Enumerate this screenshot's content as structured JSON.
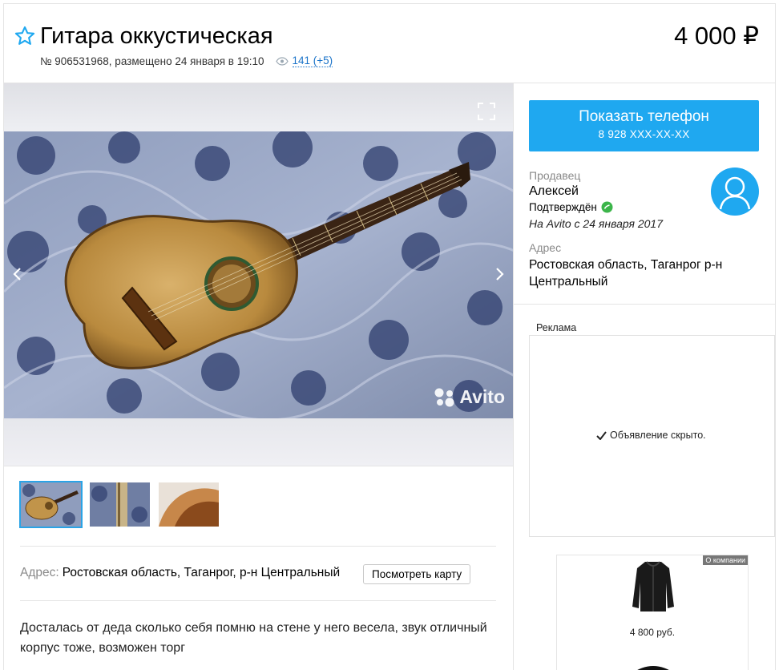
{
  "listing": {
    "title": "Гитара оккустическая",
    "price": "4 000 ₽",
    "meta": "№ 906531968, размещено 24 января в 19:10",
    "views": "141 (+5)"
  },
  "gallery": {
    "watermark": "Avito",
    "thumbnail_count": 3
  },
  "address": {
    "label": "Адрес:",
    "value": "Ростовская область, Таганрог, р-н Центральный",
    "map_button": "Посмотреть карту"
  },
  "description": "Досталась от деда сколько себя помню на стене у него весела, звук отличный корпус тоже, возможен торг",
  "contact": {
    "phone_button": "Показать телефон",
    "phone_masked": "8 928 XXX-XX-XX"
  },
  "seller": {
    "label": "Продавец",
    "name": "Алексей",
    "verified": "Подтверждён",
    "since": "На Avito с 24 января 2017",
    "address_label": "Адрес",
    "address": "Ростовская область, Таганрог р-н Центральный"
  },
  "ads": {
    "label": "Реклама",
    "hidden_text": "Объявление скрыто.",
    "company_tag": "О компании",
    "product_price": "4 800 руб."
  },
  "colors": {
    "accent": "#1fa8f0",
    "link": "#1a73c9",
    "verified": "#3cb54a"
  },
  "icons": [
    "star-icon",
    "eye-icon",
    "expand-icon",
    "chevron-left-icon",
    "chevron-right-icon",
    "avito-logo-icon",
    "check-icon",
    "user-avatar-icon",
    "verified-icon"
  ]
}
